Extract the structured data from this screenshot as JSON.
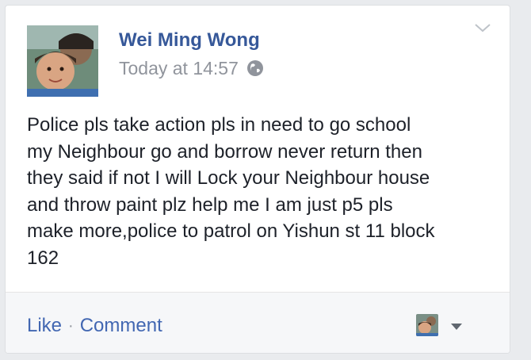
{
  "post": {
    "author": "Wei Ming Wong",
    "timestamp": "Today at 14:57",
    "privacy_icon": "globe-icon",
    "text": "Police pls take action pls in need to go school\nmy Neighbour go and borrow never return then\nthey said if not I will Lock your Neighbour house\nand throw paint plz help me I am just p5 pls\nmake more,police to patrol on Yishun st 11 block\n162"
  },
  "footer": {
    "like_label": "Like",
    "separator": "·",
    "comment_label": "Comment"
  },
  "colors": {
    "link": "#365899",
    "action": "#4267b2",
    "meta": "#90949c",
    "text": "#1d2129",
    "footer_bg": "#f6f7f9"
  }
}
